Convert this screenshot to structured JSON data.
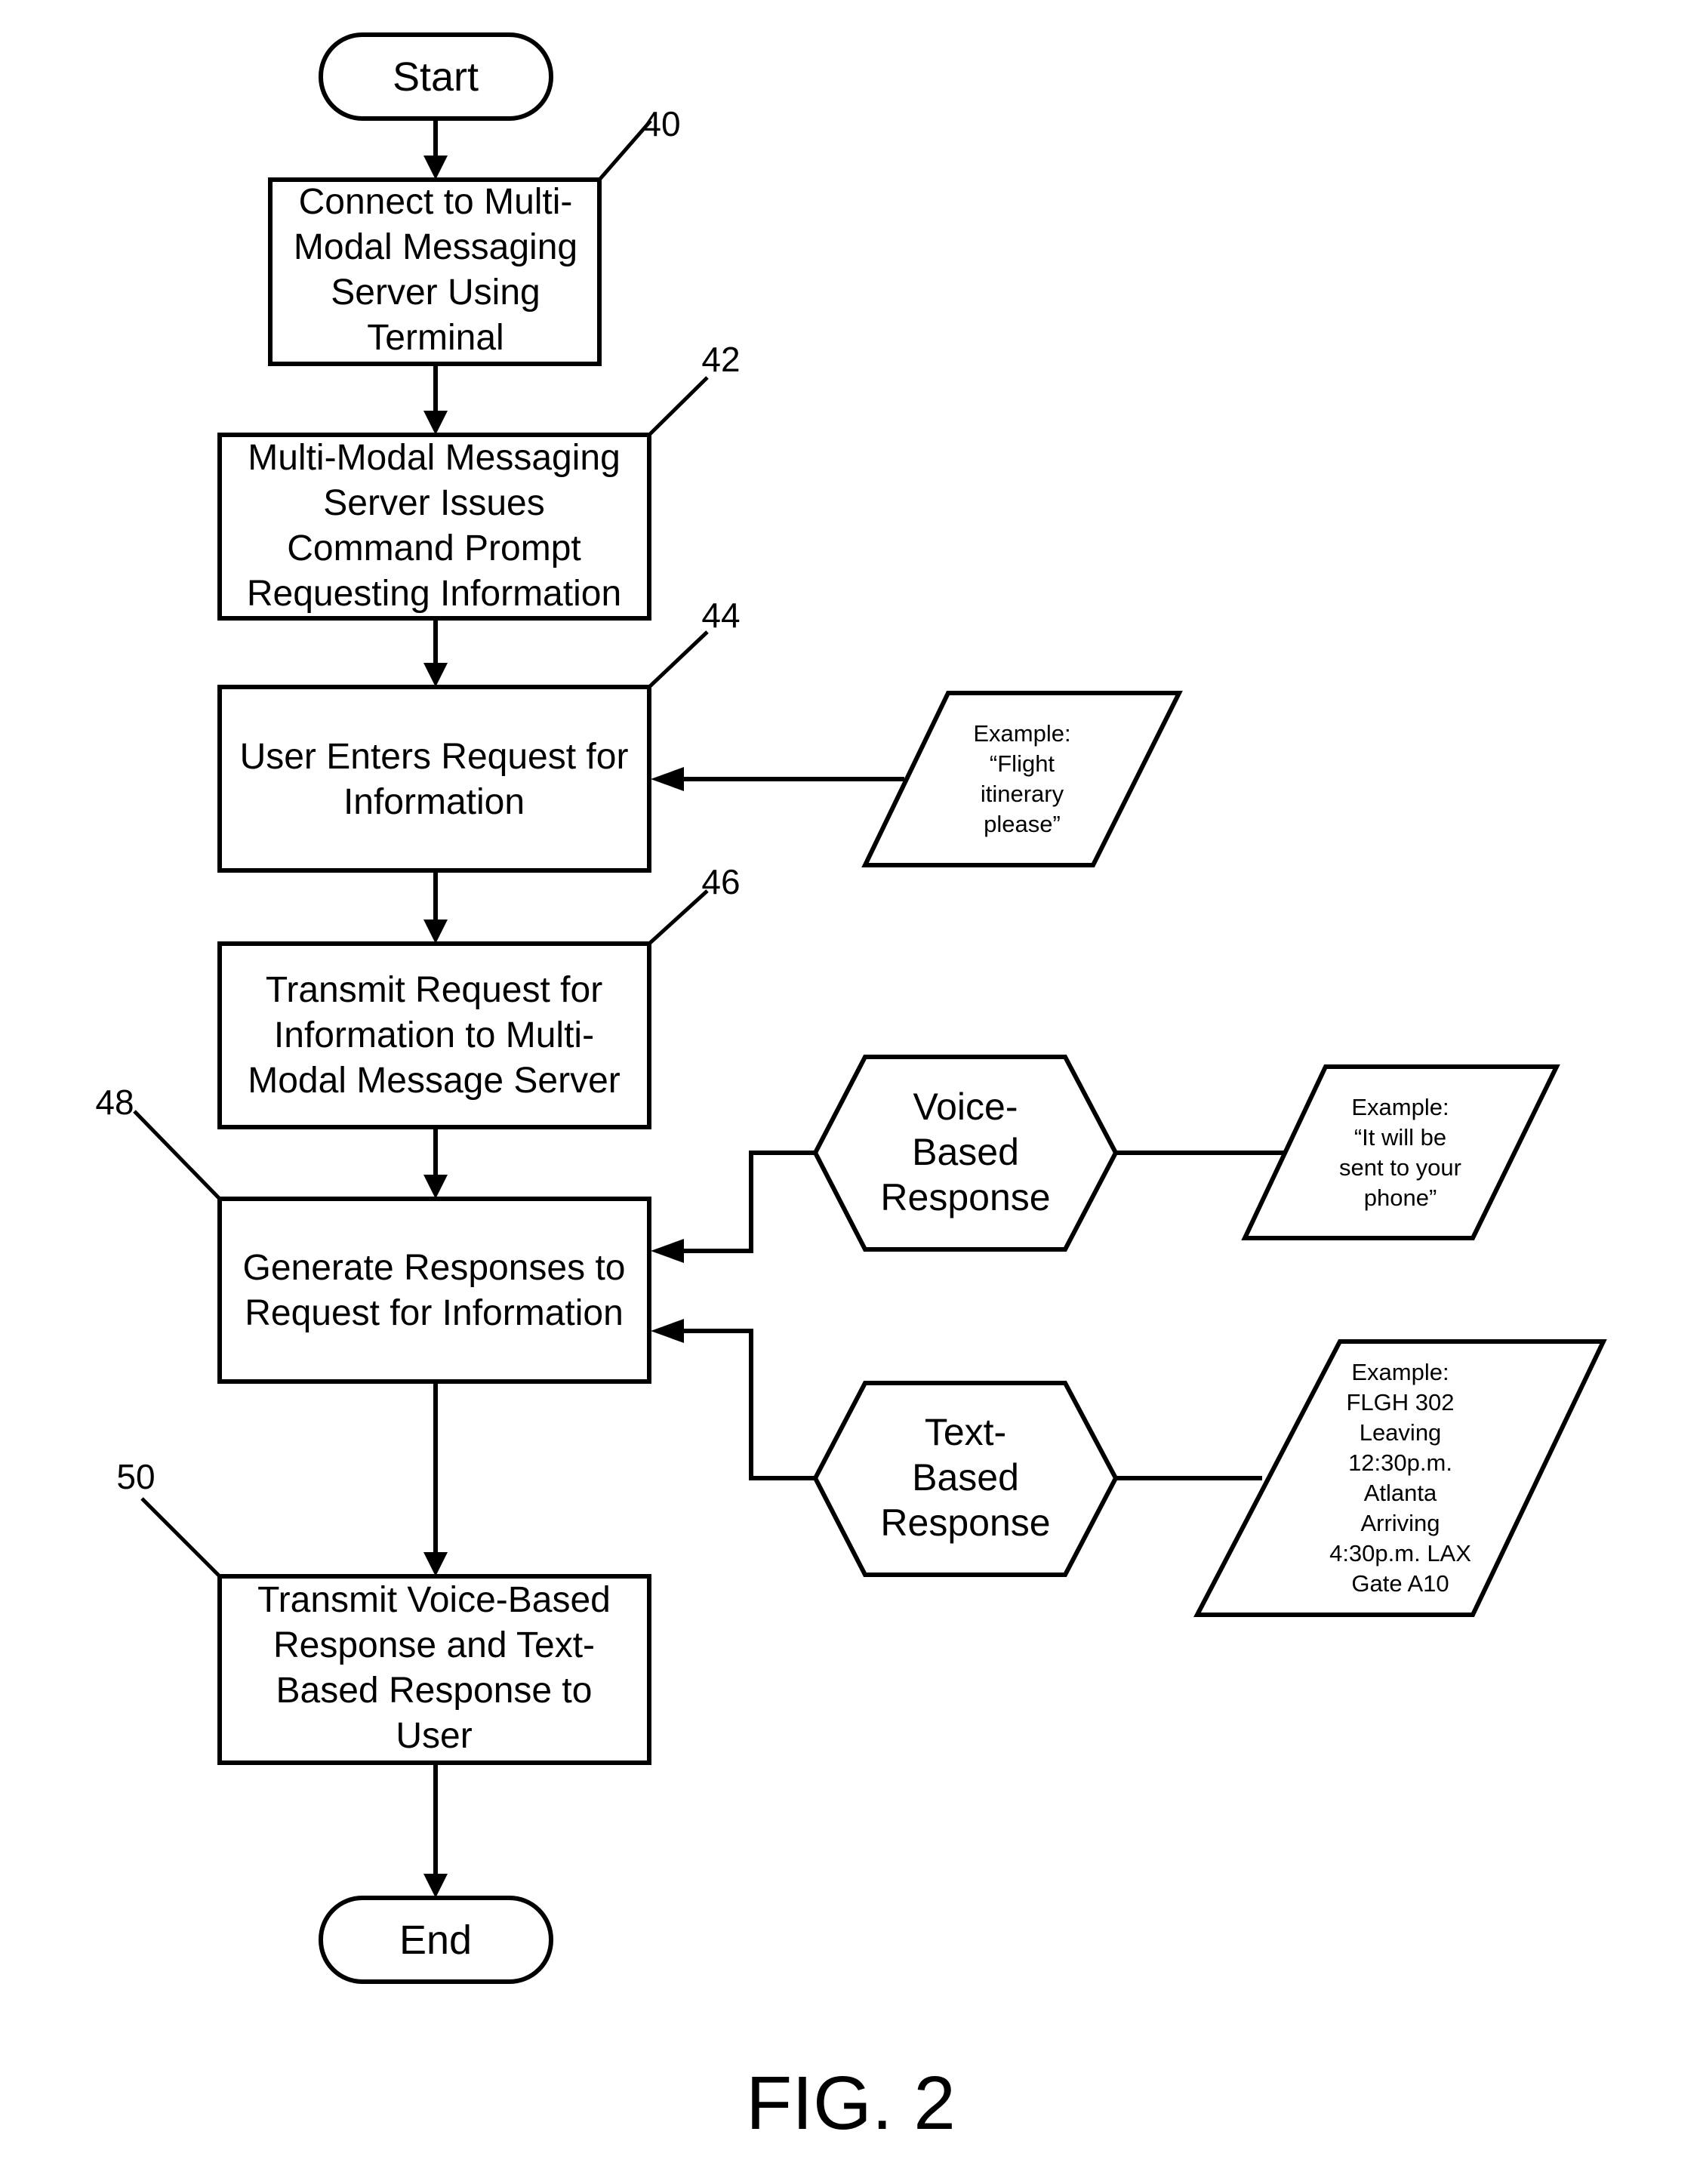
{
  "figure": {
    "caption": "FIG. 2"
  },
  "terminals": {
    "start": "Start",
    "end": "End"
  },
  "steps": [
    {
      "ref": "40",
      "lines": [
        "Connect to Multi-",
        "Modal Messaging",
        "Server Using",
        "Terminal"
      ]
    },
    {
      "ref": "42",
      "lines": [
        "Multi-Modal Messaging",
        "Server Issues",
        "Command Prompt",
        "Requesting Information"
      ]
    },
    {
      "ref": "44",
      "lines": [
        "User Enters Request for",
        "Information"
      ]
    },
    {
      "ref": "46",
      "lines": [
        "Transmit Request for",
        "Information to Multi-",
        "Modal Message Server"
      ]
    },
    {
      "ref": "48",
      "lines": [
        "Generate Responses to",
        "Request for Information"
      ]
    },
    {
      "ref": "50",
      "lines": [
        "Transmit Voice-Based",
        "Response and Text-",
        "Based Response to",
        "User"
      ]
    }
  ],
  "responses": [
    {
      "lines": [
        "Voice-",
        "Based",
        "Response"
      ]
    },
    {
      "lines": [
        "Text-",
        "Based",
        "Response"
      ]
    }
  ],
  "examples": [
    {
      "lines": [
        "Example:",
        "“Flight",
        "itinerary",
        "please”"
      ]
    },
    {
      "lines": [
        "Example:",
        "“It will be",
        "sent to your",
        "phone”"
      ]
    },
    {
      "lines": [
        "Example:",
        "FLGH 302",
        "Leaving",
        "12:30p.m.",
        "Atlanta",
        "Arriving",
        "4:30p.m. LAX",
        "Gate A10"
      ]
    }
  ]
}
